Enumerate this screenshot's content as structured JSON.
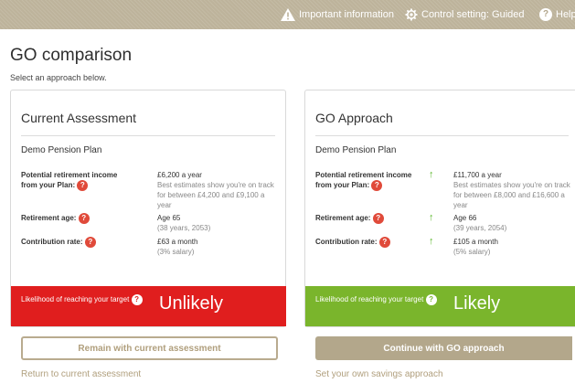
{
  "topbar": {
    "important_info": "Important information",
    "control_setting": "Control setting: Guided",
    "help": "Help",
    "help_icon_char": "?"
  },
  "page": {
    "title": "GO comparison",
    "subtitle": "Select an approach below."
  },
  "cards": [
    {
      "title": "Current Assessment",
      "plan_name": "Demo Pension Plan",
      "rows": [
        {
          "label": "Potential retirement income from your Plan:",
          "value": "£6,200 a year",
          "sub": "Best estimates show you're on track for between £4,200 and £9,100 a year",
          "arrow": ""
        },
        {
          "label": "Retirement age:",
          "value": "Age 65",
          "sub": "(38 years, 2053)",
          "arrow": ""
        },
        {
          "label": "Contribution rate:",
          "value": "£63 a month",
          "sub": "(3% salary)",
          "arrow": ""
        }
      ],
      "likelihood_label": "Likelihood of reaching your target",
      "likelihood_value": "Unlikely",
      "likelihood_color": "#e01e1e",
      "button_label": "Remain with current assessment",
      "link_label": "Return to current assessment"
    },
    {
      "title": "GO Approach",
      "plan_name": "Demo Pension Plan",
      "rows": [
        {
          "label": "Potential retirement income from your Plan:",
          "value": "£11,700 a year",
          "sub": "Best estimates show you're on track for between £8,000 and £16,600 a year",
          "arrow": "up-arrow-icon"
        },
        {
          "label": "Retirement age:",
          "value": "Age 66",
          "sub": "(39 years, 2054)",
          "arrow": "up-arrow-icon"
        },
        {
          "label": "Contribution rate:",
          "value": "£105 a month",
          "sub": "(5% salary)",
          "arrow": "up-arrow-icon"
        }
      ],
      "likelihood_label": "Likelihood of reaching your target",
      "likelihood_value": "Likely",
      "likelihood_color": "#7ab52c",
      "button_label": "Continue with GO approach",
      "link_label": "Set your own savings approach"
    }
  ],
  "help_char": "?",
  "arrow_char": "↑",
  "colors": {
    "topbar": "#bdb39b",
    "accent": "#b3a78b",
    "help_badge": "#e04a3a",
    "improvement_arrow": "#5cb82d"
  }
}
